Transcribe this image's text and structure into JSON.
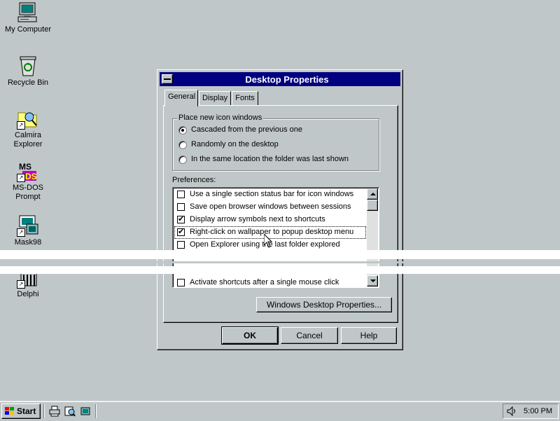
{
  "desktop": {
    "icons": [
      {
        "label": "My Computer",
        "icon": "computer-icon"
      },
      {
        "label": "Recycle Bin",
        "icon": "recycle-bin-icon"
      },
      {
        "label_line1": "Calmira",
        "label_line2": "Explorer",
        "icon": "explorer-icon"
      },
      {
        "label_line1": "MS-DOS",
        "label_line2": "Prompt",
        "icon": "msdos-icon"
      },
      {
        "label": "Mask98",
        "icon": "mask98-icon"
      },
      {
        "label": "Delphi",
        "icon": "delphi-icon"
      }
    ]
  },
  "dialog": {
    "title": "Desktop Properties",
    "tabs": [
      "General",
      "Display",
      "Fonts"
    ],
    "active_tab": "General",
    "icon_windows_group": {
      "title": "Place new icon windows",
      "options": [
        {
          "label": "Cascaded from the previous one",
          "checked": true
        },
        {
          "label": "Randomly on the desktop",
          "checked": false
        },
        {
          "label": "In the same location the folder was last shown",
          "checked": false
        }
      ]
    },
    "preferences_label": "Preferences:",
    "preferences": [
      {
        "label": "Use a single section status bar for icon windows",
        "checked": false
      },
      {
        "label": "Save open browser windows between sessions",
        "checked": false
      },
      {
        "label": "Display arrow symbols next to shortcuts",
        "checked": true
      },
      {
        "label": "Right-click on wallpaper to popup desktop menu",
        "checked": true
      },
      {
        "label": "Open Explorer using the last folder explored",
        "checked": false
      },
      {
        "label": "Activate shortcuts after a single mouse click",
        "checked": false
      }
    ],
    "windows_props_button": "Windows Desktop Properties...",
    "ok_button": "OK",
    "cancel_button": "Cancel",
    "help_button": "Help"
  },
  "taskbar": {
    "start_label": "Start",
    "quick_launch": [
      "printer-icon",
      "find-icon",
      "explorer-icon"
    ],
    "clock": "5:00 PM"
  },
  "colors": {
    "desktop": "#c0c7c8",
    "title_bar": "#000080"
  }
}
